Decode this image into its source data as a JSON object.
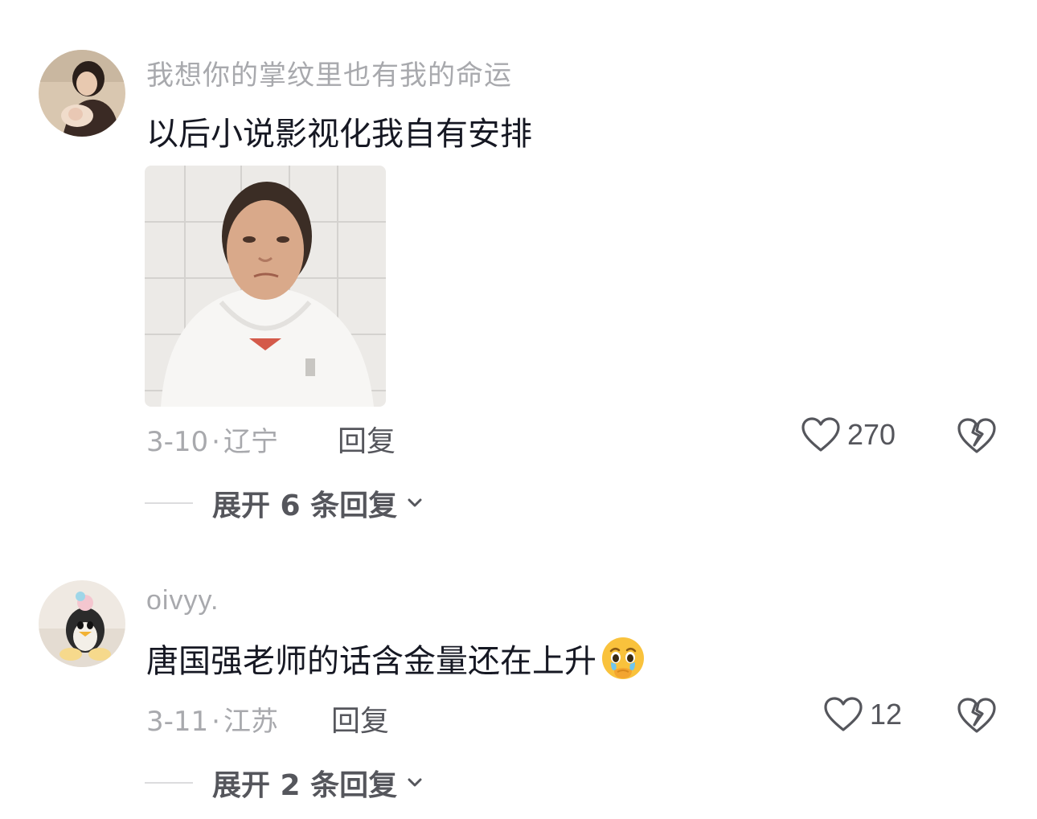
{
  "comments": [
    {
      "username": "我想你的掌纹里也有我的命运",
      "text": "以后小说影视化我自有安排",
      "date": "3-10",
      "location": "辽宁",
      "reply_label": "回复",
      "likes": "270",
      "expand_label": "展开 6 条回复",
      "has_sticker": true
    },
    {
      "username": "oivyy.",
      "text": "唐国强老师的话含金量还在上升",
      "emoji": "holding-back-tears-emoji",
      "date": "3-11",
      "location": "江苏",
      "reply_label": "回复",
      "likes": "12",
      "expand_label": "展开 2 条回复"
    }
  ],
  "colors": {
    "text_primary": "#161823",
    "text_secondary": "#a8a9ad",
    "action": "#55565c"
  }
}
